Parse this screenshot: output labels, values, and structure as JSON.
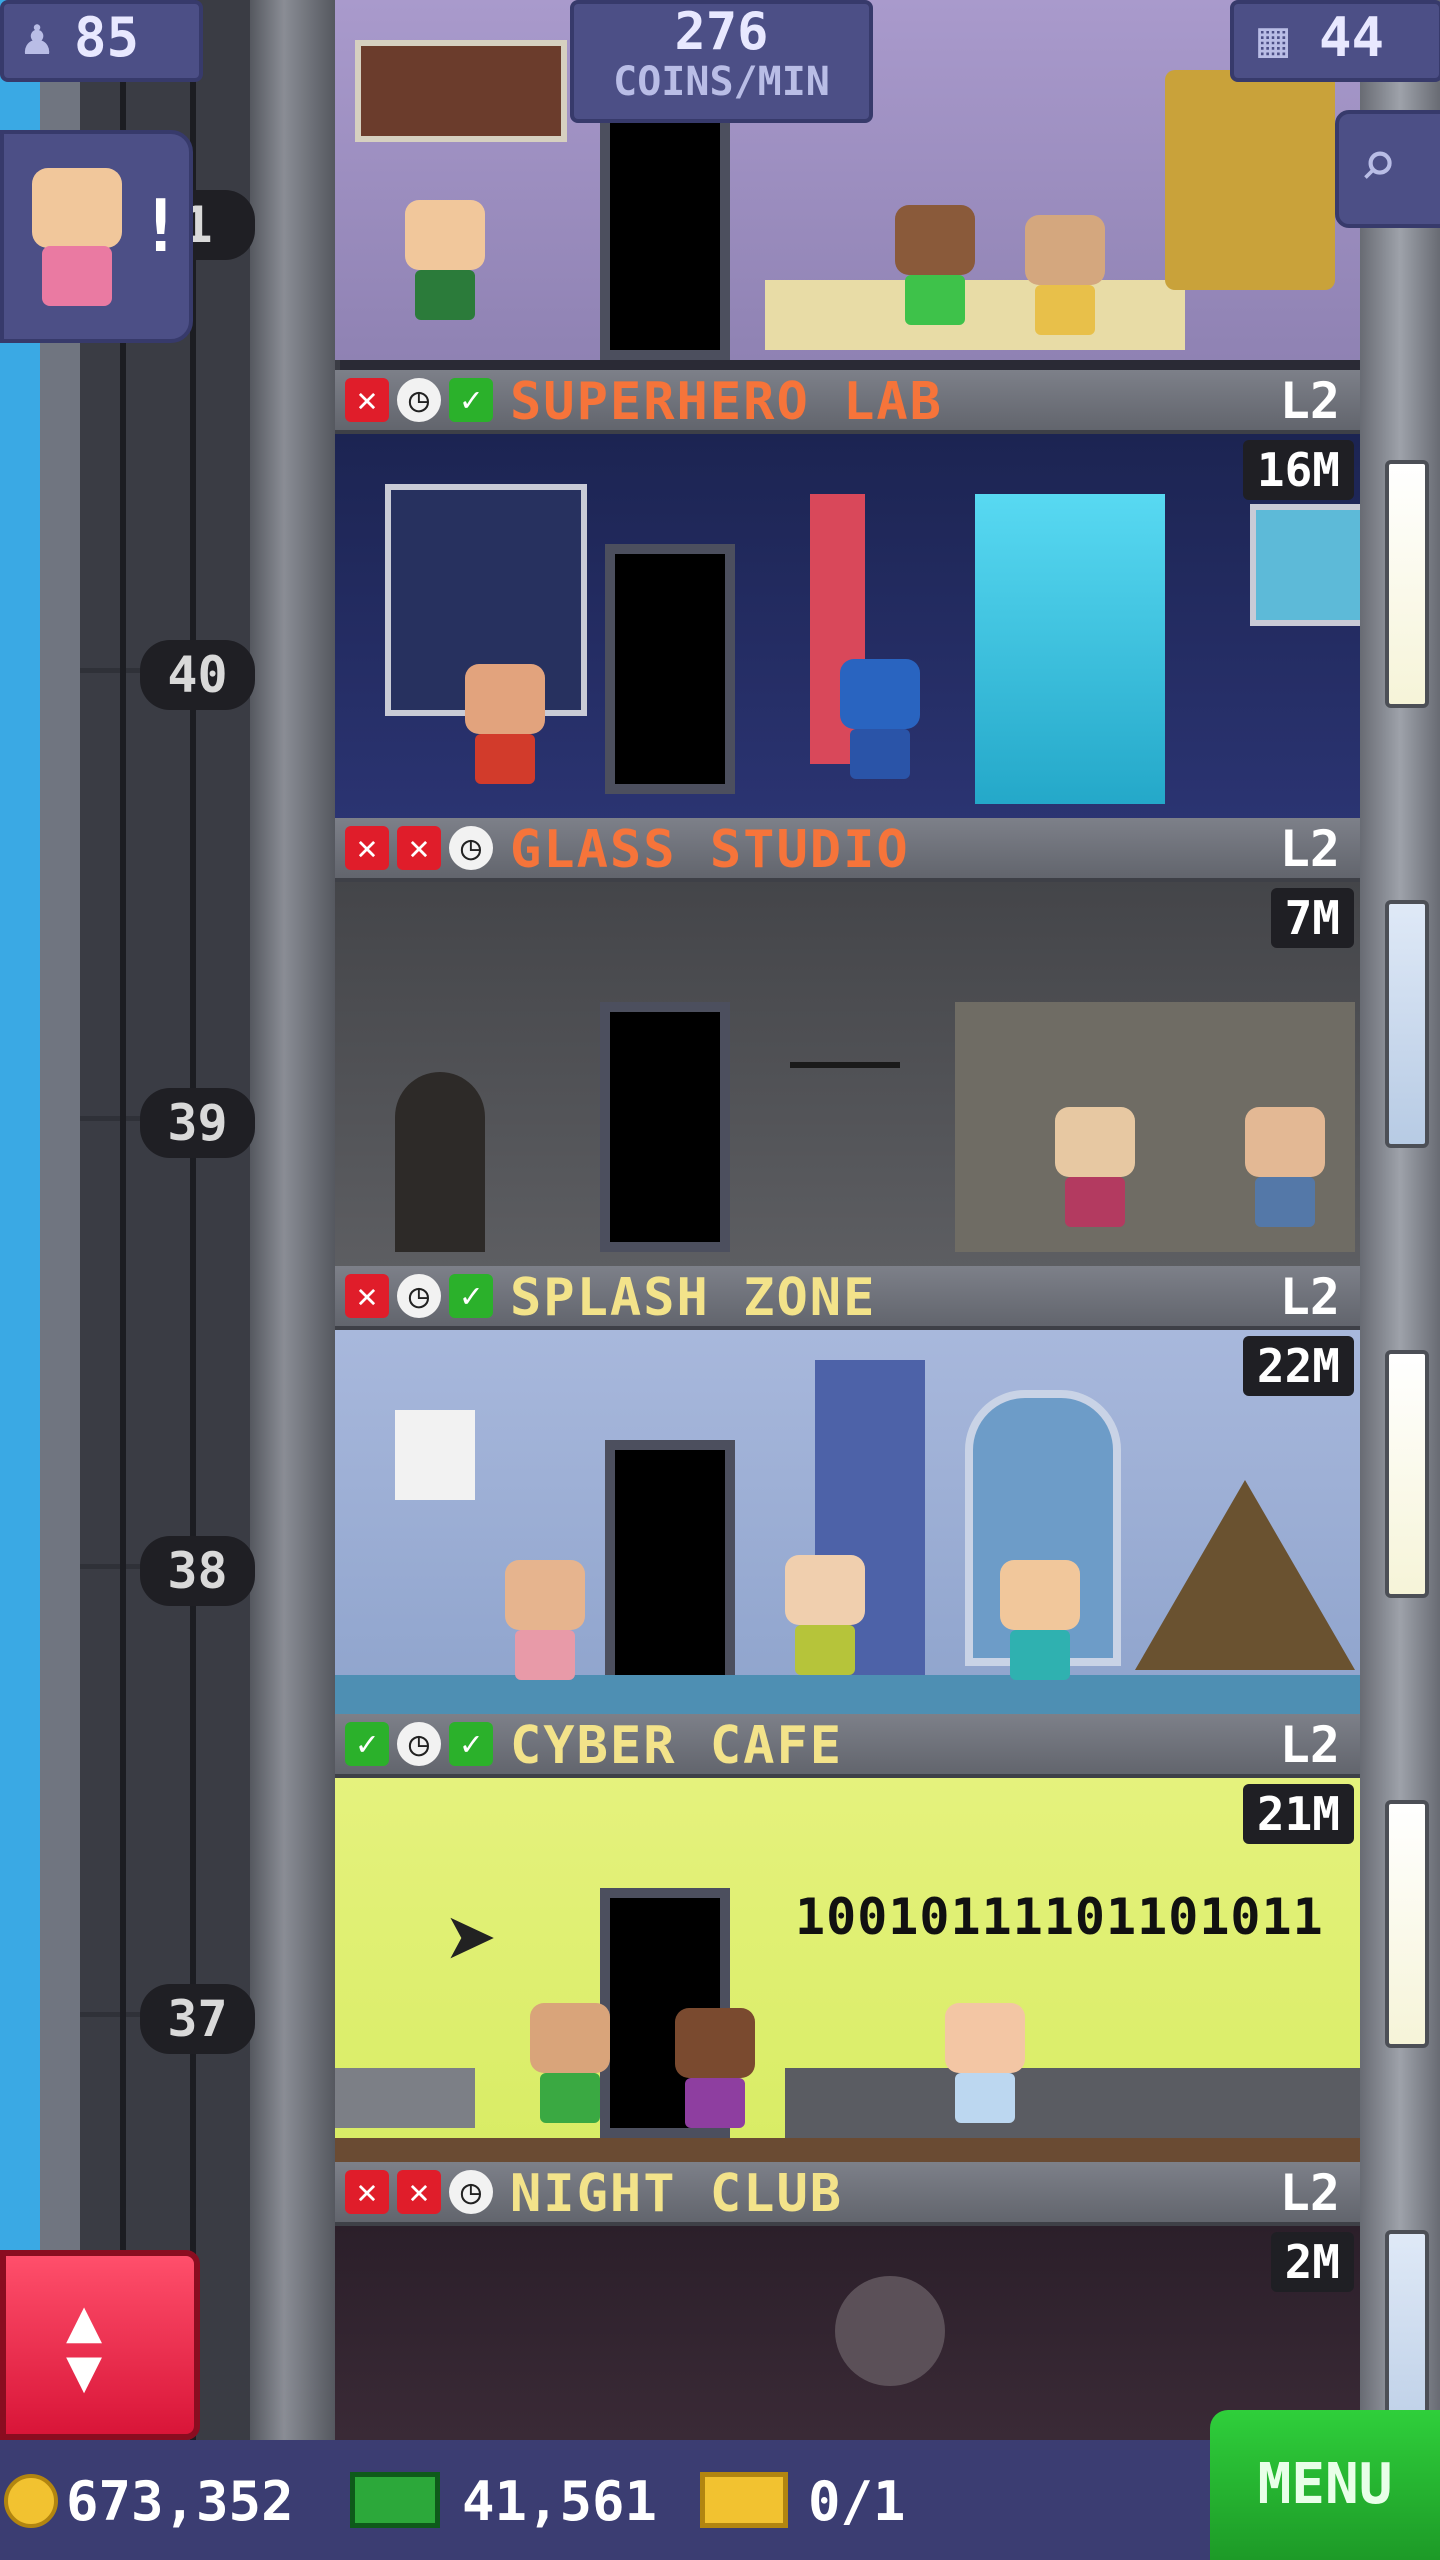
{
  "top": {
    "population": "85",
    "coins_per_min_value": "276",
    "coins_per_min_label": "COINS/MIN",
    "floors_count": "44"
  },
  "visitor_alert": {
    "mark": "!"
  },
  "shaft_floor_numbers": [
    "1",
    "40",
    "39",
    "38",
    "37"
  ],
  "floors": [
    {
      "name": "SUPERHERO LAB",
      "level": "L2",
      "price": "16M",
      "status": [
        "x",
        "clock",
        "check"
      ],
      "name_color": "#f6743a"
    },
    {
      "name": "GLASS STUDIO",
      "level": "L2",
      "price": "7M",
      "status": [
        "x",
        "x",
        "clock"
      ],
      "name_color": "#f6743a"
    },
    {
      "name": "SPLASH ZONE",
      "level": "L2",
      "price": "22M",
      "status": [
        "x",
        "clock",
        "check"
      ],
      "name_color": "#f3e38a"
    },
    {
      "name": "CYBER CAFE",
      "level": "L2",
      "price": "21M",
      "status": [
        "check",
        "clock",
        "check"
      ],
      "name_color": "#f3e38a"
    },
    {
      "name": "NIGHT CLUB",
      "level": "L2",
      "price": "2M",
      "status": [
        "x",
        "x",
        "clock"
      ],
      "name_color": "#f3e38a"
    }
  ],
  "cafe_binary": "10010111101101011",
  "bottom": {
    "coins": "673,352",
    "bux": "41,561",
    "tickets": "0/1",
    "menu_label": "MENU"
  },
  "icons": {
    "population": "person-icon",
    "floors": "building-icon",
    "search": "magnifier-icon",
    "coin": "coin-icon",
    "bux": "cash-icon",
    "ticket": "ticket-icon",
    "elevator": "up-down-arrows-icon"
  }
}
